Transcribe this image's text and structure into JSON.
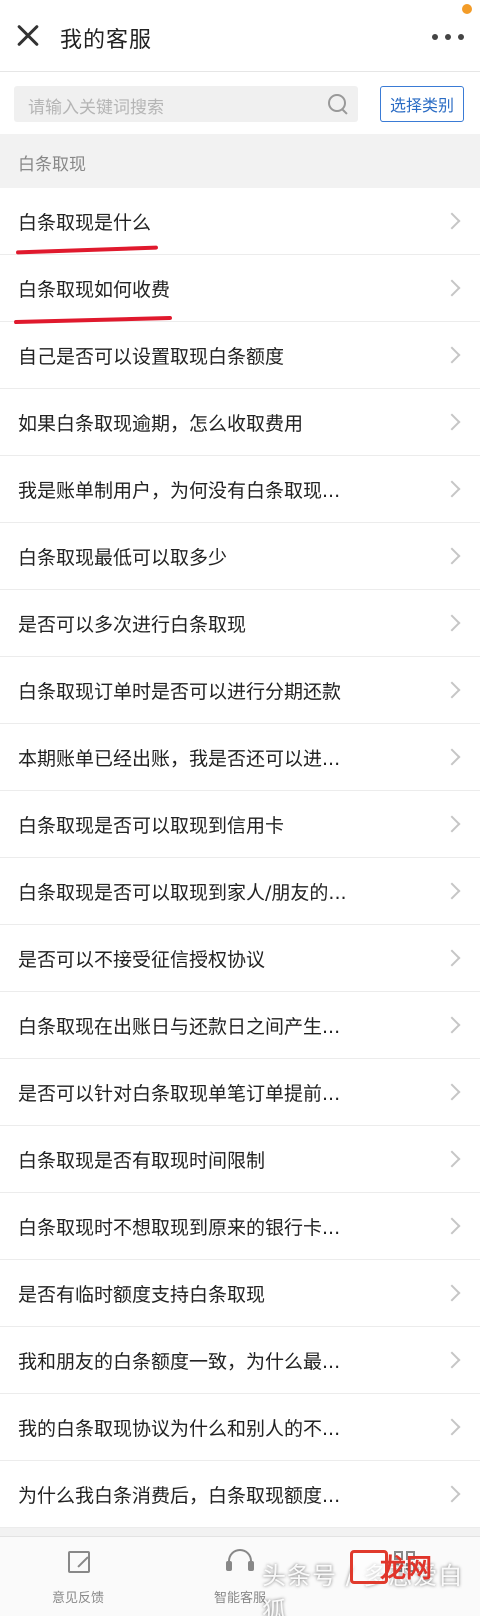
{
  "header": {
    "title": "我的客服"
  },
  "search": {
    "placeholder": "请输入关键词搜索",
    "category_label": "选择类别"
  },
  "section": {
    "title": "白条取现"
  },
  "items": [
    {
      "label": "白条取现是什么"
    },
    {
      "label": "白条取现如何收费"
    },
    {
      "label": "自己是否可以设置取现白条额度"
    },
    {
      "label": "如果白条取现逾期，怎么收取费用"
    },
    {
      "label": "我是账单制用户，为何没有白条取现..."
    },
    {
      "label": "白条取现最低可以取多少"
    },
    {
      "label": "是否可以多次进行白条取现"
    },
    {
      "label": "白条取现订单时是否可以进行分期还款"
    },
    {
      "label": "本期账单已经出账，我是否还可以进..."
    },
    {
      "label": "白条取现是否可以取现到信用卡"
    },
    {
      "label": "白条取现是否可以取现到家人/朋友的..."
    },
    {
      "label": "是否可以不接受征信授权协议"
    },
    {
      "label": "白条取现在出账日与还款日之间产生..."
    },
    {
      "label": "是否可以针对白条取现单笔订单提前..."
    },
    {
      "label": "白条取现是否有取现时间限制"
    },
    {
      "label": "白条取现时不想取现到原来的银行卡..."
    },
    {
      "label": "是否有临时额度支持白条取现"
    },
    {
      "label": "我和朋友的白条额度一致，为什么最..."
    },
    {
      "label": "我的白条取现协议为什么和别人的不..."
    },
    {
      "label": "为什么我白条消费后，白条取现额度..."
    }
  ],
  "tabbar": {
    "feedback_label": "意见反馈",
    "smart_label": "智能客服"
  },
  "watermark": {
    "text": "头条号 / 多恋爱白狐",
    "logo_text": "龙网"
  },
  "colors": {
    "accent": "#2b6cc4",
    "highlight_red": "#e0192d",
    "badge_orange": "#f39c28"
  }
}
